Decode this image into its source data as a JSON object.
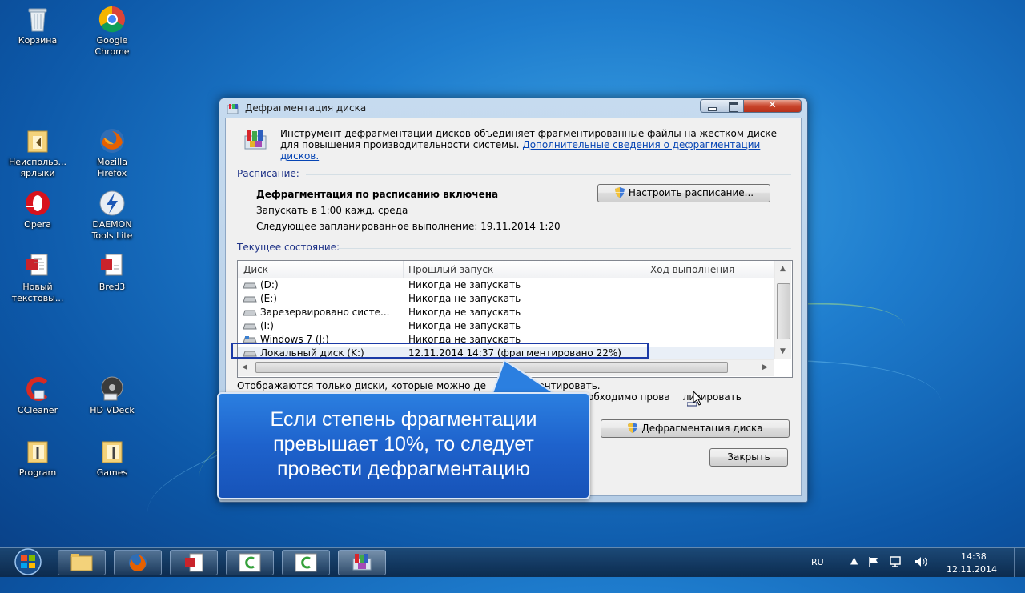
{
  "desktop_icons": [
    {
      "label": "Корзина"
    },
    {
      "label": "Google Chrome"
    },
    {
      "label": "Неиспольз... ярлыки"
    },
    {
      "label": "Mozilla Firefox"
    },
    {
      "label": "Opera"
    },
    {
      "label": "DAEMON Tools Lite"
    },
    {
      "label": "Новый текстовы..."
    },
    {
      "label": "Bred3"
    },
    {
      "label": "CCleaner"
    },
    {
      "label": "HD VDeck"
    },
    {
      "label": "Program"
    },
    {
      "label": "Games"
    }
  ],
  "window": {
    "title": "Дефрагментация диска",
    "intro_text": "Инструмент дефрагментации дисков объединяет фрагментированные файлы на жестком диске для повышения производительности системы.",
    "intro_link": "Дополнительные сведения о дефрагментации дисков.",
    "schedule_label": "Расписание:",
    "schedule_status": "Дефрагментация по расписанию включена",
    "schedule_run": "Запускать в 1:00 кажд. среда",
    "schedule_next": "Следующее запланированное выполнение: 19.11.2014 1:20",
    "configure_button": "Настроить расписание...",
    "current_state_label": "Текущее состояние:",
    "columns": [
      "Диск",
      "Прошлый запуск",
      "Ход выполнения"
    ],
    "rows": [
      {
        "disk": "(D:)",
        "last_run": "Никогда не запускать"
      },
      {
        "disk": "(E:)",
        "last_run": "Никогда не запускать"
      },
      {
        "disk": "Зарезервировано систе...",
        "last_run": "Никогда не запускать"
      },
      {
        "disk": "(I:)",
        "last_run": "Никогда не запускать"
      },
      {
        "disk": "Windows 7 (J:)",
        "last_run": "Никогда не запускать"
      },
      {
        "disk": "Локальный диск (K:)",
        "last_run": "12.11.2014 14:37 (фрагментировано 22%)"
      }
    ],
    "footer_text_1": "Отображаются только диски, которые можно де",
    "footer_text_1b": "гментировать.",
    "footer_text_2": "обходимо прова",
    "footer_text_2b": "лизировать",
    "defrag_button": "Дефрагментация диска",
    "close_button": "Закрыть"
  },
  "callout_text": "Если степень фрагментации превышает 10%, то следует провести дефрагментацию",
  "tray": {
    "lang": "RU",
    "time": "14:38",
    "date": "12.11.2014"
  }
}
